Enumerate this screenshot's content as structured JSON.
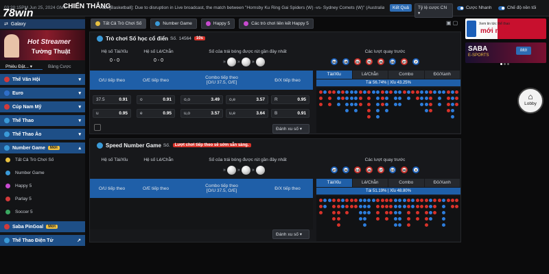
{
  "topbar": {
    "time": "03:20:15PM Jun 25, 2024 GMT +7",
    "logo_main": "78win",
    "logo_sub": "CHIẾN THẮNG",
    "announcement": "Attn [Basketball]: Due to disruption in Live broadcast, the match between \"Hornsby Ku Ring Gai Spiders (W) -vs- Sydney Comets (W)\" (Australia",
    "result_button": "Kết Quả",
    "odds_select": "Tỷ lệ cược CN",
    "fast_bet_label": "Cược Nhanh",
    "mode_label": "Chế độ nền tối"
  },
  "sidebar": {
    "galaxy": "Galaxy",
    "promo_line1": "Hot Streamer",
    "promo_line2": "Tường Thuật",
    "tab_favorite": "Phiêu Đặt...",
    "tab_board": "Bảng Cược",
    "categories": [
      {
        "label": "Thể Văn Hội",
        "color": "#d23a3a"
      },
      {
        "label": "Euro",
        "color": "#2f6fc8"
      },
      {
        "label": "Cúp Nam Mỹ",
        "color": "#d23a3a"
      },
      {
        "label": "Thể Thao",
        "color": "#3a9ad8"
      },
      {
        "label": "Thể Thao Ảo",
        "color": "#3a9ad8"
      }
    ],
    "number_game": "Number Game",
    "new_badge": "Mới",
    "number_items": [
      "Tất Cả Trò Chơi Số",
      "Number Game",
      "Happy 5",
      "Parlay 5",
      "Soccer 5"
    ],
    "pingoal": "Saba PinGoal",
    "esports": "Thể Thao Điện Tử"
  },
  "tabs": [
    "Tất Cả Trò Chơi Số",
    "Number Game",
    "Happy 5",
    "Các trò chơi liên kết Happy 5"
  ],
  "panel1": {
    "title": "Trò chơi Số học cổ điển",
    "round_prefix": "Số.",
    "round_no": "14564",
    "timer": "10s",
    "col1": "Hệ số Tài/Xỉu",
    "col2": "Hệ số Lẻ/Chẵn",
    "col3": "Số của trái bóng được rút gần đây nhất",
    "col1_val": "0 - 0",
    "col2_val": "0 - 0",
    "prev_label": "Các lượt quay trước",
    "prev_numbers": [
      "54",
      "18",
      "31",
      "70",
      "25",
      "16",
      "37",
      "7"
    ],
    "hdr_ou": "O/U tiếp theo",
    "hdr_oe": "O/E tiếp theo",
    "hdr_combo": "Combo tiếp theo",
    "hdr_combo_sub": "[O/U 37.5, O/E]",
    "hdr_ox": "Đ/X tiếp theo",
    "odds": [
      [
        "37.5",
        "0.91",
        "o",
        "0.91",
        "o,o",
        "3.49",
        "o,e",
        "3.57",
        "R",
        "0.95"
      ],
      [
        "u",
        "0.95",
        "e",
        "0.95",
        "u,o",
        "3.57",
        "u,e",
        "3.64",
        "B",
        "0.91"
      ]
    ],
    "bet_label": "Đánh xu số",
    "subtabs": [
      "Tài/Xỉu",
      "Lẻ/Chẵn",
      "Combo",
      "Đỏ/Xanh"
    ],
    "stat": "Tài 56.74% | Xỉu 43.25%"
  },
  "panel2": {
    "title": "Speed Number Game",
    "round_prefix": "Số.",
    "notice": "Lượt chơi tiếp theo sẽ sớm sẵn sàng.",
    "col1": "Hệ số Tài/Xỉu",
    "col2": "Hệ số Lẻ/Chẵn",
    "col3": "Số của trái bóng được rút gần đây nhất",
    "prev_label": "Các lượt quay trước",
    "prev_numbers": [
      "47",
      "34",
      "13",
      "45",
      "17",
      "12",
      "58",
      "3"
    ],
    "hdr_ou": "O/U tiếp theo",
    "hdr_oe": "O/E tiếp theo",
    "hdr_combo": "Combo tiếp theo",
    "hdr_combo_sub": "[O/U 37.5, O/E]",
    "hdr_ox": "Đ/X tiếp theo",
    "bet_label": "Đánh xu số",
    "subtabs": [
      "Tài/Xỉu",
      "Lẻ/Chẵn",
      "Combo",
      "Đỏ/Xanh"
    ],
    "stat": "Tài 51.19% | Xỉu 48.80%"
  },
  "right": {
    "banner1_line1": "Xem tin tức thể thao",
    "banner1_line2": "mới nhất",
    "banner2_brand": "SABA",
    "banner2_sub": "E-SPORTS",
    "lobby": "Lobby"
  }
}
